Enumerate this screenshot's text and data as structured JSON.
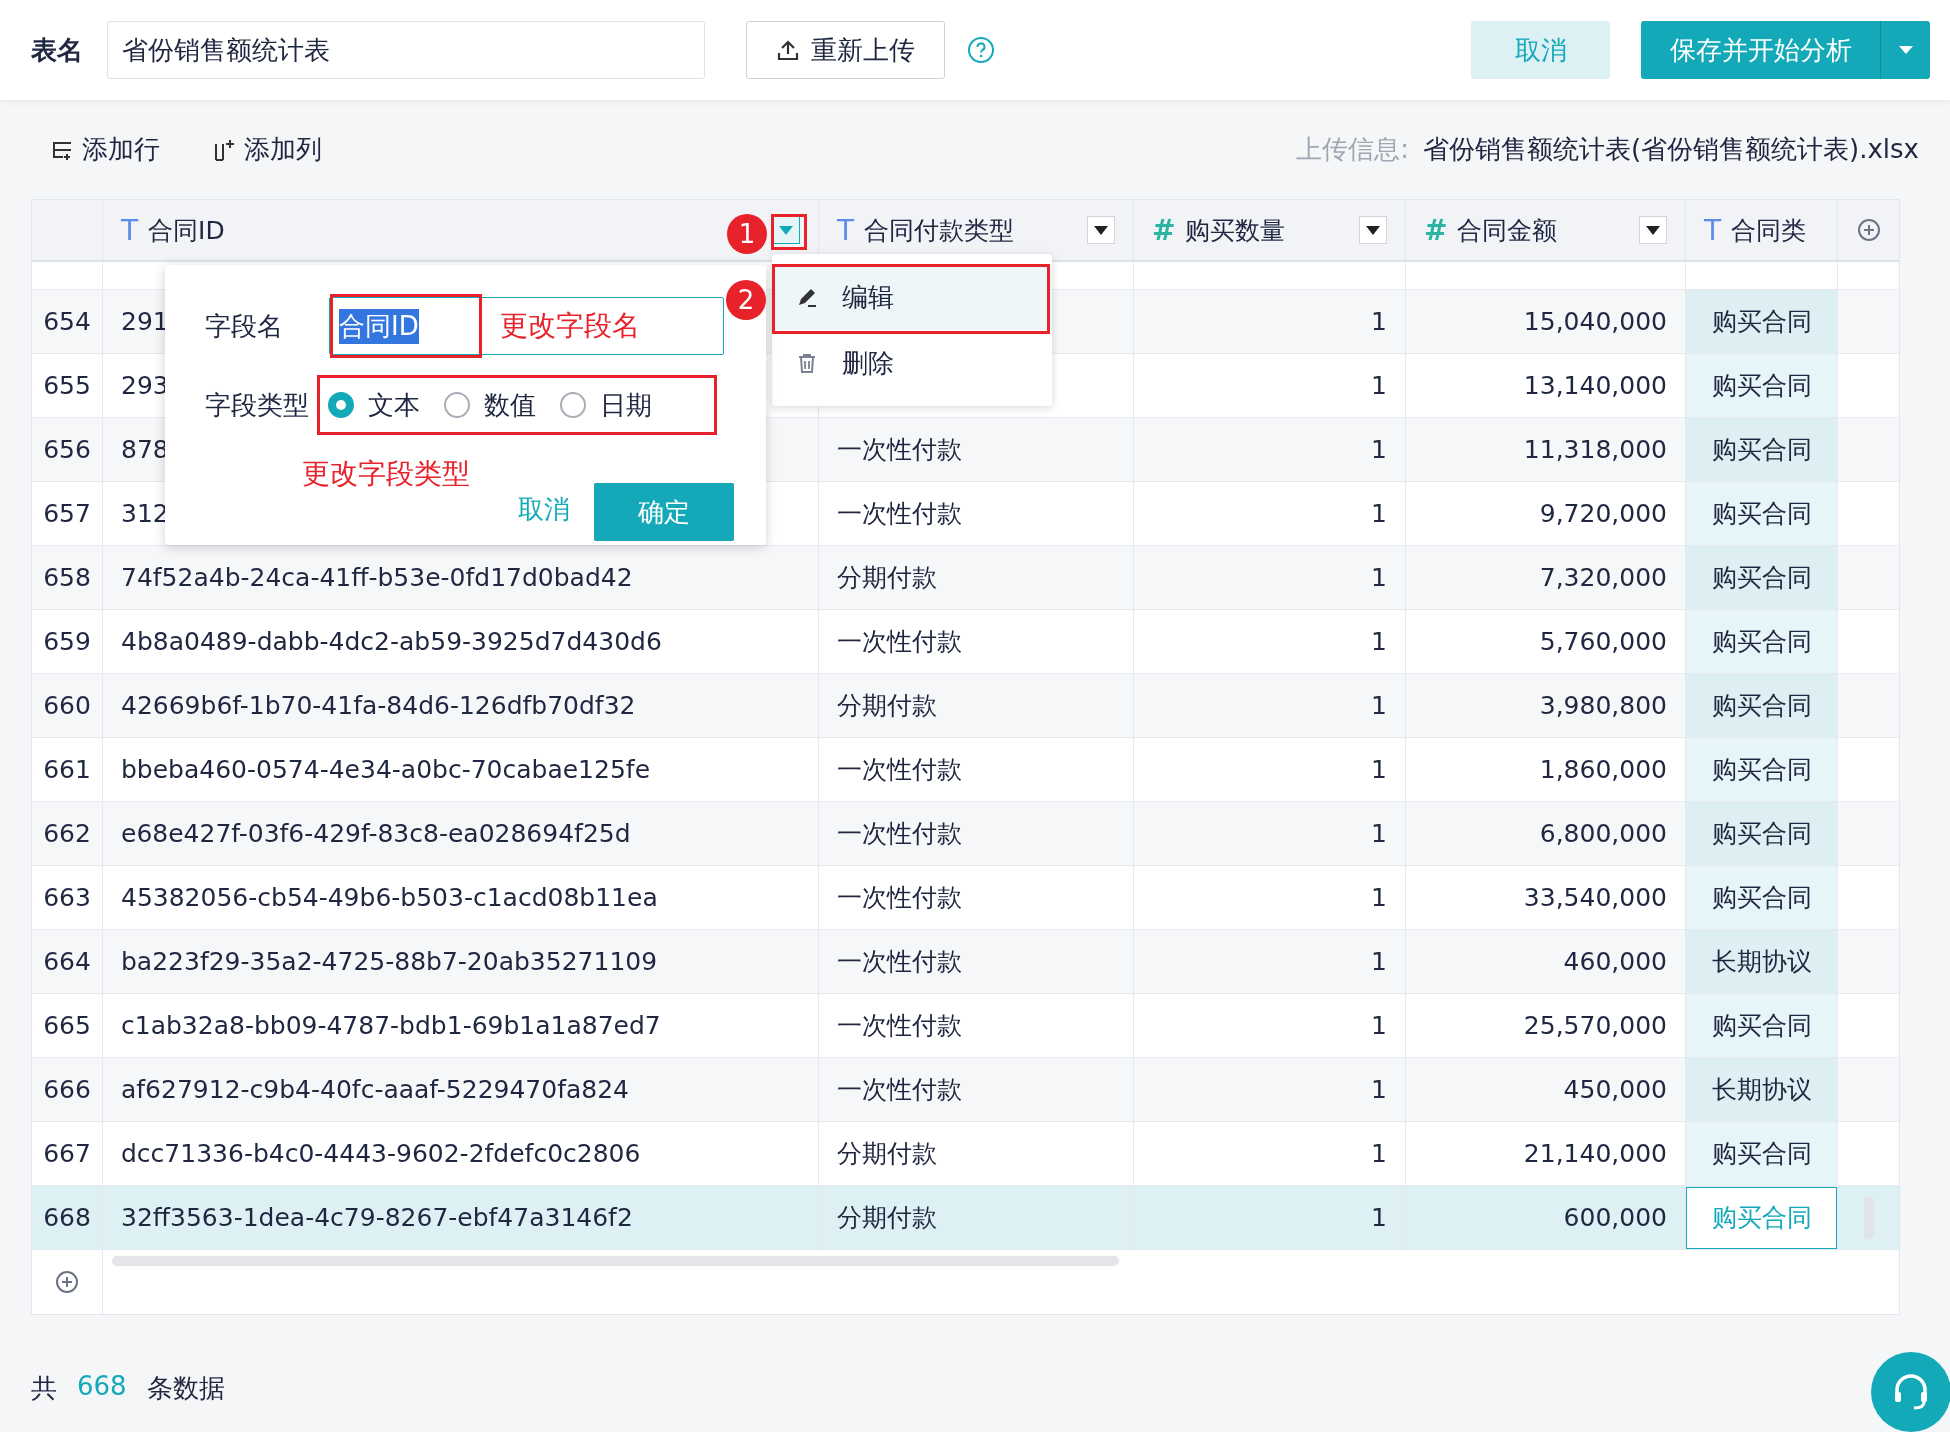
{
  "header": {
    "title_label": "表名",
    "table_name": "省份销售额统计表",
    "reupload_button": "重新上传",
    "cancel_button": "取消",
    "save_button": "保存并开始分析"
  },
  "toolbar": {
    "add_row": "添加行",
    "add_column": "添加列",
    "upload_info_label": "上传信息:",
    "upload_info_value": "省份销售额统计表(省份销售额统计表).xlsx"
  },
  "table": {
    "columns": [
      {
        "type_icon": "T",
        "name": "合同ID",
        "kind": "text",
        "menu_open": true
      },
      {
        "type_icon": "T",
        "name": "合同付款类型",
        "kind": "text",
        "menu_open": false
      },
      {
        "type_icon": "#",
        "name": "购买数量",
        "kind": "number",
        "menu_open": false
      },
      {
        "type_icon": "#",
        "name": "合同金额",
        "kind": "number",
        "menu_open": false
      },
      {
        "type_icon": "T",
        "name": "合同类",
        "kind": "text"
      }
    ],
    "rows": [
      {
        "number": "654",
        "id": "291",
        "quantity": "1",
        "amount": "15,040,000",
        "contract_type": "购买合同",
        "selected": false
      },
      {
        "number": "655",
        "id": "293",
        "quantity": "1",
        "amount": "13,140,000",
        "contract_type": "购买合同",
        "selected": false
      },
      {
        "number": "656",
        "id": "878",
        "payment": "一次性付款",
        "quantity": "1",
        "amount": "11,318,000",
        "contract_type": "购买合同",
        "selected": false
      },
      {
        "number": "657",
        "id": "312",
        "payment": "一次性付款",
        "quantity": "1",
        "amount": "9,720,000",
        "contract_type": "购买合同",
        "selected": false
      },
      {
        "number": "658",
        "id": "74f52a4b-24ca-41ff-b53e-0fd17d0bad42",
        "payment": "分期付款",
        "quantity": "1",
        "amount": "7,320,000",
        "contract_type": "购买合同",
        "selected": false
      },
      {
        "number": "659",
        "id": "4b8a0489-dabb-4dc2-ab59-3925d7d430d6",
        "payment": "一次性付款",
        "quantity": "1",
        "amount": "5,760,000",
        "contract_type": "购买合同",
        "selected": false
      },
      {
        "number": "660",
        "id": "42669b6f-1b70-41fa-84d6-126dfb70df32",
        "payment": "分期付款",
        "quantity": "1",
        "amount": "3,980,800",
        "contract_type": "购买合同",
        "selected": false
      },
      {
        "number": "661",
        "id": "bbeba460-0574-4e34-a0bc-70cabae125fe",
        "payment": "一次性付款",
        "quantity": "1",
        "amount": "1,860,000",
        "contract_type": "购买合同",
        "selected": false
      },
      {
        "number": "662",
        "id": "e68e427f-03f6-429f-83c8-ea028694f25d",
        "payment": "一次性付款",
        "quantity": "1",
        "amount": "6,800,000",
        "contract_type": "购买合同",
        "selected": false
      },
      {
        "number": "663",
        "id": "45382056-cb54-49b6-b503-c1acd08b11ea",
        "payment": "一次性付款",
        "quantity": "1",
        "amount": "33,540,000",
        "contract_type": "购买合同",
        "selected": false
      },
      {
        "number": "664",
        "id": "ba223f29-35a2-4725-88b7-20ab35271109",
        "payment": "一次性付款",
        "quantity": "1",
        "amount": "460,000",
        "contract_type": "长期协议",
        "selected": false
      },
      {
        "number": "665",
        "id": "c1ab32a8-bb09-4787-bdb1-69b1a1a87ed7",
        "payment": "一次性付款",
        "quantity": "1",
        "amount": "25,570,000",
        "contract_type": "购买合同",
        "selected": false
      },
      {
        "number": "666",
        "id": "af627912-c9b4-40fc-aaaf-5229470fa824",
        "payment": "一次性付款",
        "quantity": "1",
        "amount": "450,000",
        "contract_type": "长期协议",
        "selected": false
      },
      {
        "number": "667",
        "id": "dcc71336-b4c0-4443-9602-2fdefc0c2806",
        "payment": "分期付款",
        "quantity": "1",
        "amount": "21,140,000",
        "contract_type": "购买合同",
        "selected": false
      },
      {
        "number": "668",
        "id": "32ff3563-1dea-4c79-8267-ebf47a3146f2",
        "payment": "分期付款",
        "quantity": "1",
        "amount": "600,000",
        "contract_type": "购买合同",
        "selected": true
      }
    ]
  },
  "column_menu": {
    "items": [
      {
        "label": "编辑",
        "kind": "edit",
        "highlighted": true
      },
      {
        "label": "删除",
        "kind": "delete",
        "highlighted": false
      }
    ]
  },
  "edit_popup": {
    "field_name_label": "字段名",
    "field_name_value": "合同ID",
    "field_type_label": "字段类型",
    "types": [
      {
        "label": "文本",
        "selected": true
      },
      {
        "label": "数值",
        "selected": false
      },
      {
        "label": "日期",
        "selected": false
      }
    ],
    "cancel_link": "取消",
    "confirm_button": "确定"
  },
  "annotations": {
    "markers": [
      "1",
      "2"
    ],
    "notes": [
      "更改字段名",
      "更改字段类型"
    ]
  },
  "footer": {
    "prefix": "共",
    "count": "668",
    "suffix": "条数据"
  }
}
